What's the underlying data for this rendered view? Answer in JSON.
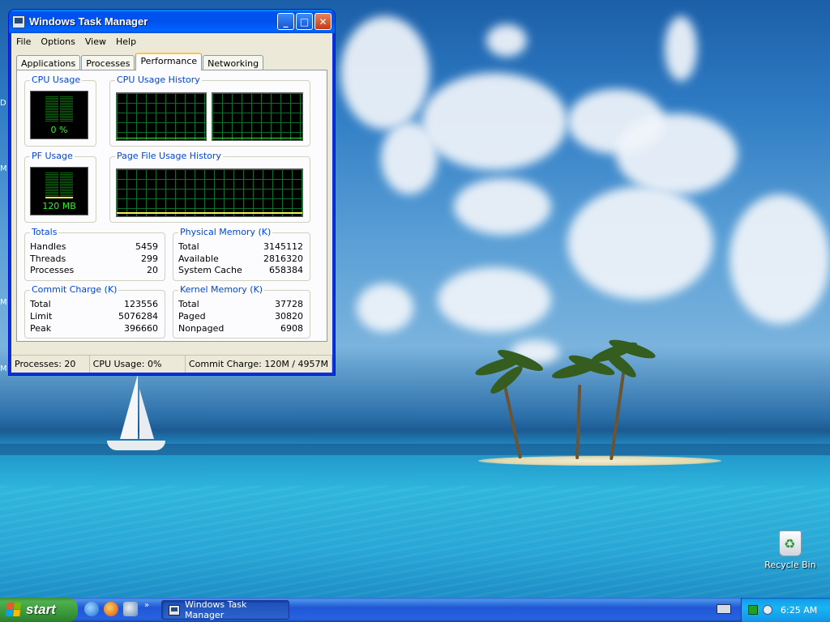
{
  "window": {
    "title": "Windows Task Manager",
    "controls": {
      "minimize": "_",
      "maximize": "□",
      "close": "✕"
    }
  },
  "menu": [
    "File",
    "Options",
    "View",
    "Help"
  ],
  "tabs": [
    "Applications",
    "Processes",
    "Performance",
    "Networking"
  ],
  "active_tab": "Performance",
  "performance": {
    "cpu_usage": {
      "label": "CPU Usage",
      "reading": "0 %",
      "percent": 0
    },
    "cpu_history": {
      "label": "CPU Usage History"
    },
    "pf_usage": {
      "label": "PF Usage",
      "reading": "120 MB"
    },
    "pf_history": {
      "label": "Page File Usage History"
    },
    "totals": {
      "label": "Totals",
      "rows": [
        {
          "k": "Handles",
          "v": "5459"
        },
        {
          "k": "Threads",
          "v": "299"
        },
        {
          "k": "Processes",
          "v": "20"
        }
      ]
    },
    "physical_memory": {
      "label": "Physical Memory (K)",
      "rows": [
        {
          "k": "Total",
          "v": "3145112"
        },
        {
          "k": "Available",
          "v": "2816320"
        },
        {
          "k": "System Cache",
          "v": "658384"
        }
      ]
    },
    "commit_charge": {
      "label": "Commit Charge (K)",
      "rows": [
        {
          "k": "Total",
          "v": "123556"
        },
        {
          "k": "Limit",
          "v": "5076284"
        },
        {
          "k": "Peak",
          "v": "396660"
        }
      ]
    },
    "kernel_memory": {
      "label": "Kernel Memory (K)",
      "rows": [
        {
          "k": "Total",
          "v": "37728"
        },
        {
          "k": "Paged",
          "v": "30820"
        },
        {
          "k": "Nonpaged",
          "v": "6908"
        }
      ]
    }
  },
  "status_bar": {
    "processes": "Processes: 20",
    "cpu": "CPU Usage: 0%",
    "commit": "Commit Charge: 120M / 4957M"
  },
  "desktop": {
    "recycle_bin": "Recycle Bin",
    "edge_letters": [
      "D",
      "M",
      "M",
      "M"
    ]
  },
  "taskbar": {
    "start_label": "start",
    "quick_launch_icons": [
      "internet-explorer-icon",
      "firefox-icon",
      "media-player-icon"
    ],
    "chevron": "»",
    "task_button": "Windows Task Manager",
    "clock": "6:25 AM"
  },
  "colors": {
    "titlebar": "#0053ee",
    "window_face": "#ece9d8",
    "graph_green": "#2df52d",
    "taskbar": "#2157d7",
    "start_green": "#3a9a3a"
  }
}
